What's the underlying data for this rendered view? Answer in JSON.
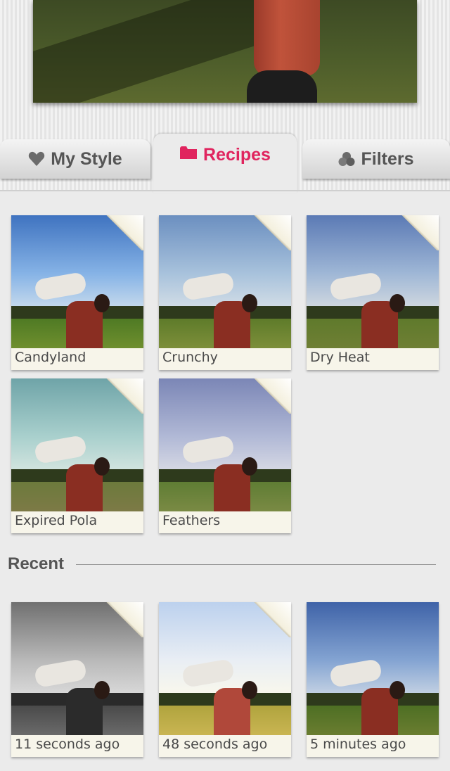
{
  "tabs": {
    "my_style": {
      "label": "My Style",
      "icon": "heart-icon"
    },
    "recipes": {
      "label": "Recipes",
      "icon": "folder-icon",
      "active": true
    },
    "filters": {
      "label": "Filters",
      "icon": "circles-icon"
    }
  },
  "colors": {
    "accent": "#e0245e",
    "tab_text": "#555555"
  },
  "recipes": [
    {
      "label": "Candyland",
      "style": "candyland",
      "has_curl": true
    },
    {
      "label": "Crunchy",
      "style": "crunchy",
      "has_curl": true
    },
    {
      "label": "Dry Heat",
      "style": "dryheat",
      "has_curl": true
    },
    {
      "label": "Expired Pola",
      "style": "expired",
      "has_curl": true
    },
    {
      "label": "Feathers",
      "style": "feathers",
      "has_curl": true
    }
  ],
  "recent": {
    "title": "Recent",
    "items": [
      {
        "label": "11 seconds ago",
        "style": "bw",
        "has_curl": true
      },
      {
        "label": "48 seconds ago",
        "style": "bright",
        "has_curl": true
      },
      {
        "label": "5 minutes ago",
        "style": "normal",
        "has_curl": false
      }
    ]
  }
}
